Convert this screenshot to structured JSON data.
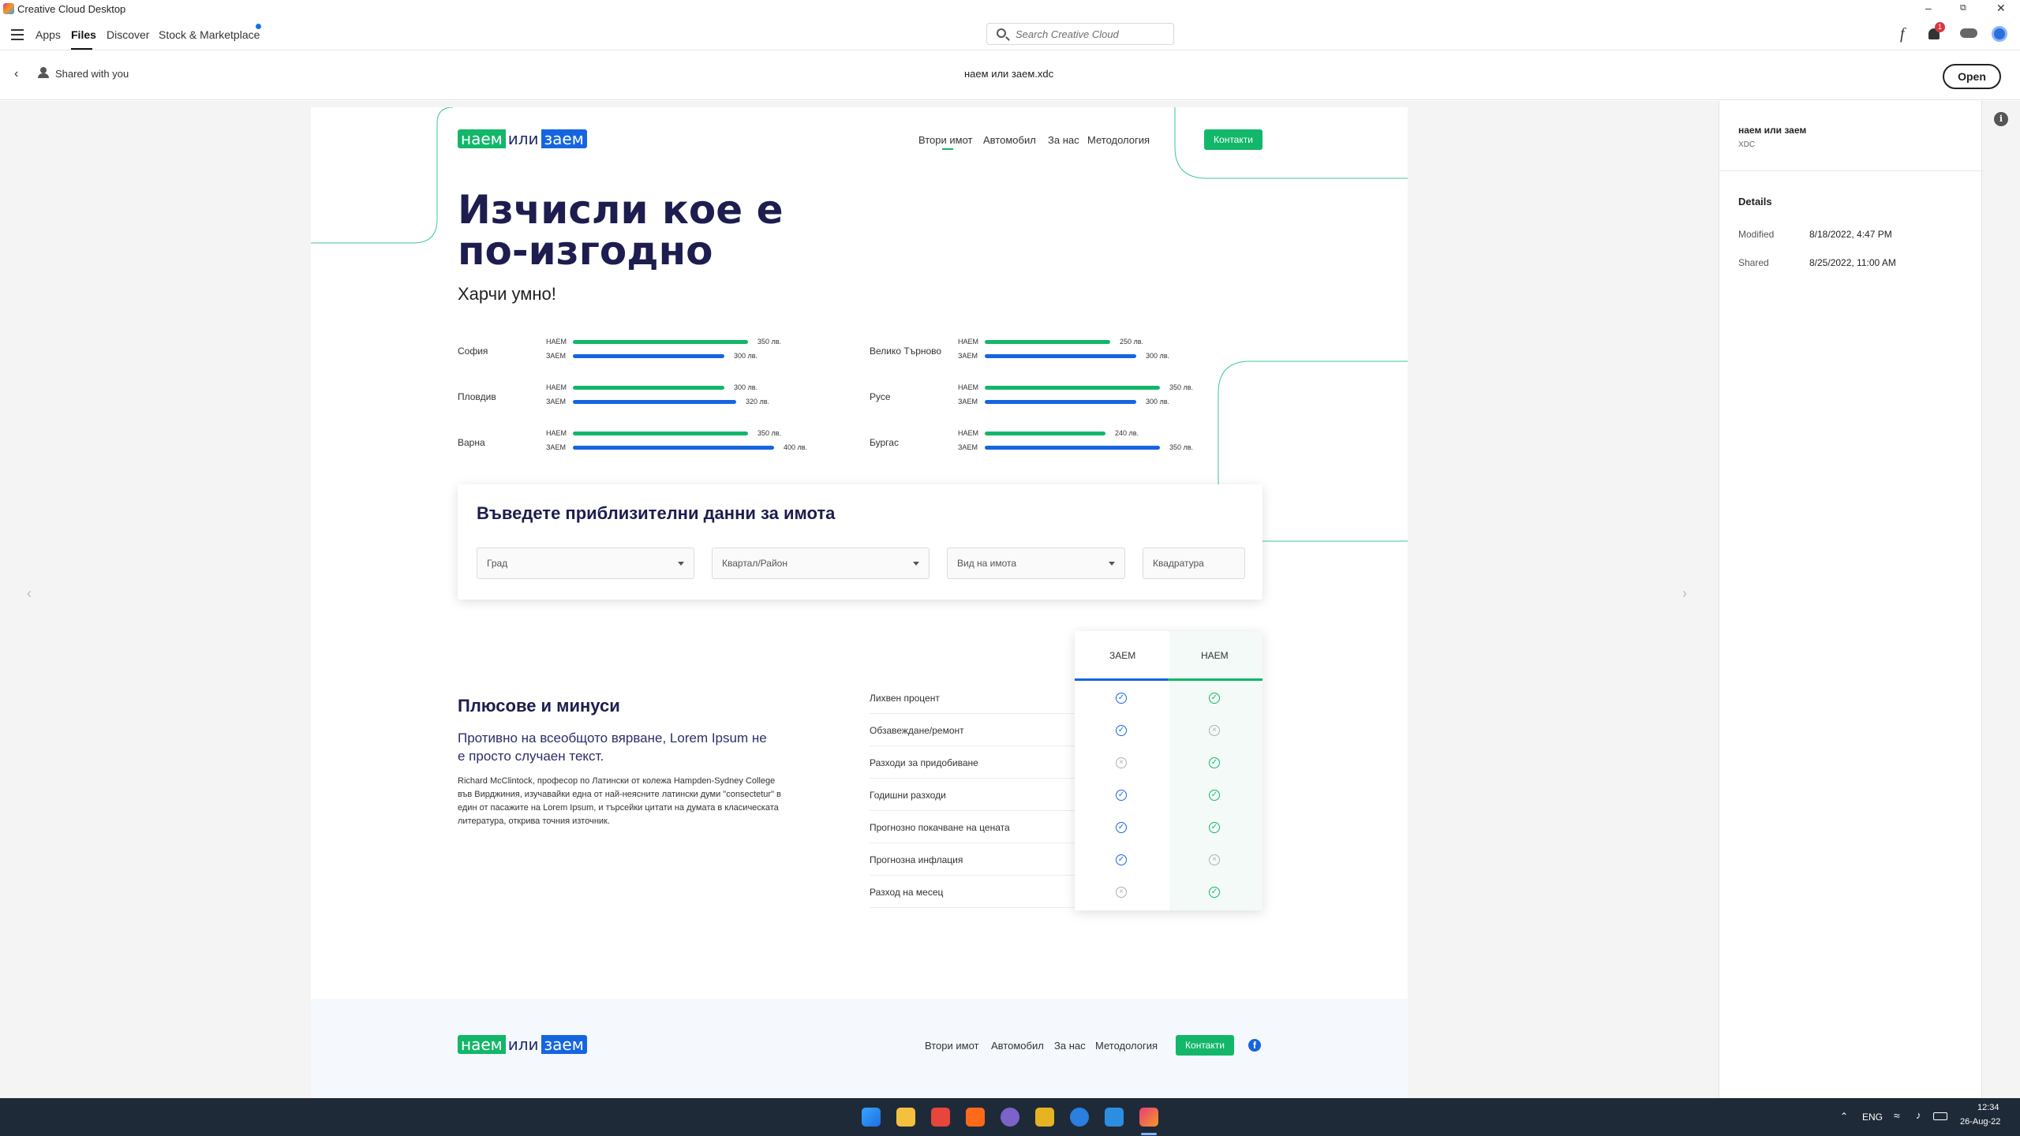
{
  "window": {
    "title": "Creative Cloud Desktop"
  },
  "menubar": {
    "tabs": [
      "Apps",
      "Files",
      "Discover",
      "Stock & Marketplace"
    ],
    "active": "Files",
    "search_placeholder": "Search Creative Cloud",
    "notification_count": "1"
  },
  "subbar": {
    "back_label": "Shared with you",
    "file_name": "наем или заем.xdc",
    "open_label": "Open"
  },
  "artboard": {
    "logo": {
      "part1": "наем",
      "part2": "или",
      "part3": "заем"
    },
    "nav": [
      "Втори имот",
      "Автомобил",
      "За нас",
      "Методология"
    ],
    "contact_label": "Контакти",
    "headline": "Изчисли кое е по-изгодно",
    "subheadline": "Харчи умно!",
    "stats": [
      {
        "city": "София",
        "rent": "350 лв.",
        "loan": "300 лв.",
        "rent_fraction": 0.54,
        "loan_fraction": 0.44
      },
      {
        "city": "Пловдив",
        "rent": "300 лв.",
        "loan": "320 лв.",
        "rent_fraction": 0.44,
        "loan_fraction": 0.49
      },
      {
        "city": "Варна",
        "rent": "350 лв.",
        "loan": "400 лв.",
        "rent_fraction": 0.54,
        "loan_fraction": 0.65
      },
      {
        "city": "Велико Търново",
        "rent": "250 лв.",
        "loan": "300 лв.",
        "rent_fraction": 0.33,
        "loan_fraction": 0.44
      },
      {
        "city": "Русе",
        "rent": "350 лв.",
        "loan": "300 лв.",
        "rent_fraction": 0.54,
        "loan_fraction": 0.44
      },
      {
        "city": "Бургас",
        "rent": "240 лв.",
        "loan": "350 лв.",
        "rent_fraction": 0.31,
        "loan_fraction": 0.54
      }
    ],
    "rent_label": "НАЕМ",
    "loan_label": "ЗАЕМ",
    "form": {
      "title": "Въведете приблизителни данни за имота",
      "city": "Град",
      "district": "Квартал/Район",
      "type": "Вид на имота",
      "area": "Квадратура"
    },
    "pros": {
      "title": "Плюсове и минуси",
      "lead": "Противно на всеобщото вярване, Lorem Ipsum не е просто случаен текст.",
      "body": "Richard McClintock, професор по Латински от колежа Hampden-Sydney College във Вирджиния, изучавайки една от най-неясните латински думи \"consectetur\" в един от пасажите на Lorem Ipsum, и търсейки цитати на думата в класическата литература, открива точния източник."
    },
    "compare": {
      "col_loan": "ЗАЕМ",
      "col_rent": "НАЕМ",
      "rows": [
        {
          "label": "Лихвен процент",
          "loan": "check",
          "rent": "check"
        },
        {
          "label": "Обзавеждане/ремонт",
          "loan": "check",
          "rent": "cross"
        },
        {
          "label": "Разходи за придобиване",
          "loan": "cross",
          "rent": "check"
        },
        {
          "label": "Годишни разходи",
          "loan": "check",
          "rent": "check"
        },
        {
          "label": "Прогнозно покачване на цената",
          "loan": "check",
          "rent": "check"
        },
        {
          "label": "Прогнозна инфлация",
          "loan": "check",
          "rent": "cross"
        },
        {
          "label": "Разход на месец",
          "loan": "cross",
          "rent": "check"
        }
      ]
    },
    "footer": {
      "nav": [
        "Втори имот",
        "Автомобил",
        "За нас",
        "Методология"
      ],
      "contact_label": "Контакти"
    }
  },
  "panel": {
    "file_title": "наем или заем",
    "file_type": "XDC",
    "details_heading": "Details",
    "modified_label": "Modified",
    "modified_value": "8/18/2022, 4:47 PM",
    "shared_label": "Shared",
    "shared_value": "8/25/2022, 11:00 AM"
  },
  "taskbar": {
    "lang": "ENG",
    "time": "12:34",
    "date": "26-Aug-22"
  }
}
